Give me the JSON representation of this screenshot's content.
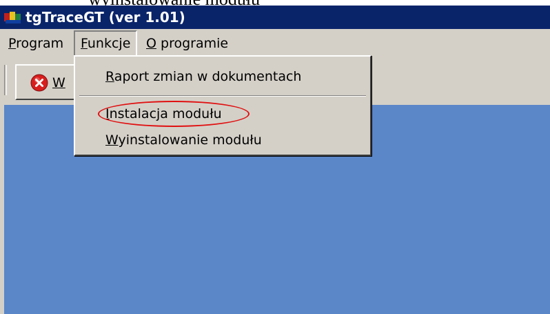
{
  "doc_fragment": "wyinstalowanie modułu",
  "window": {
    "title": "tgTraceGT (ver 1.01)"
  },
  "menubar": {
    "items": [
      {
        "label_first": "P",
        "label_rest": "rogram"
      },
      {
        "label_first": "F",
        "label_rest": "unkcje"
      },
      {
        "label_first": "O",
        "label_rest": " programie"
      }
    ]
  },
  "toolbar": {
    "button_first": "W",
    "button_icon": "stop-icon"
  },
  "dropdown": {
    "items": [
      {
        "label_first": "R",
        "label_rest": "aport zmian w dokumentach"
      },
      {
        "label_first": "I",
        "label_rest": "nstalacja modułu"
      },
      {
        "label_first": "W",
        "label_rest": "yinstalowanie modułu"
      }
    ]
  },
  "colors": {
    "titlebar": "#0a246a",
    "chrome": "#d4d0c8",
    "workspace": "#5b86c8",
    "annotation": "#e01010"
  }
}
